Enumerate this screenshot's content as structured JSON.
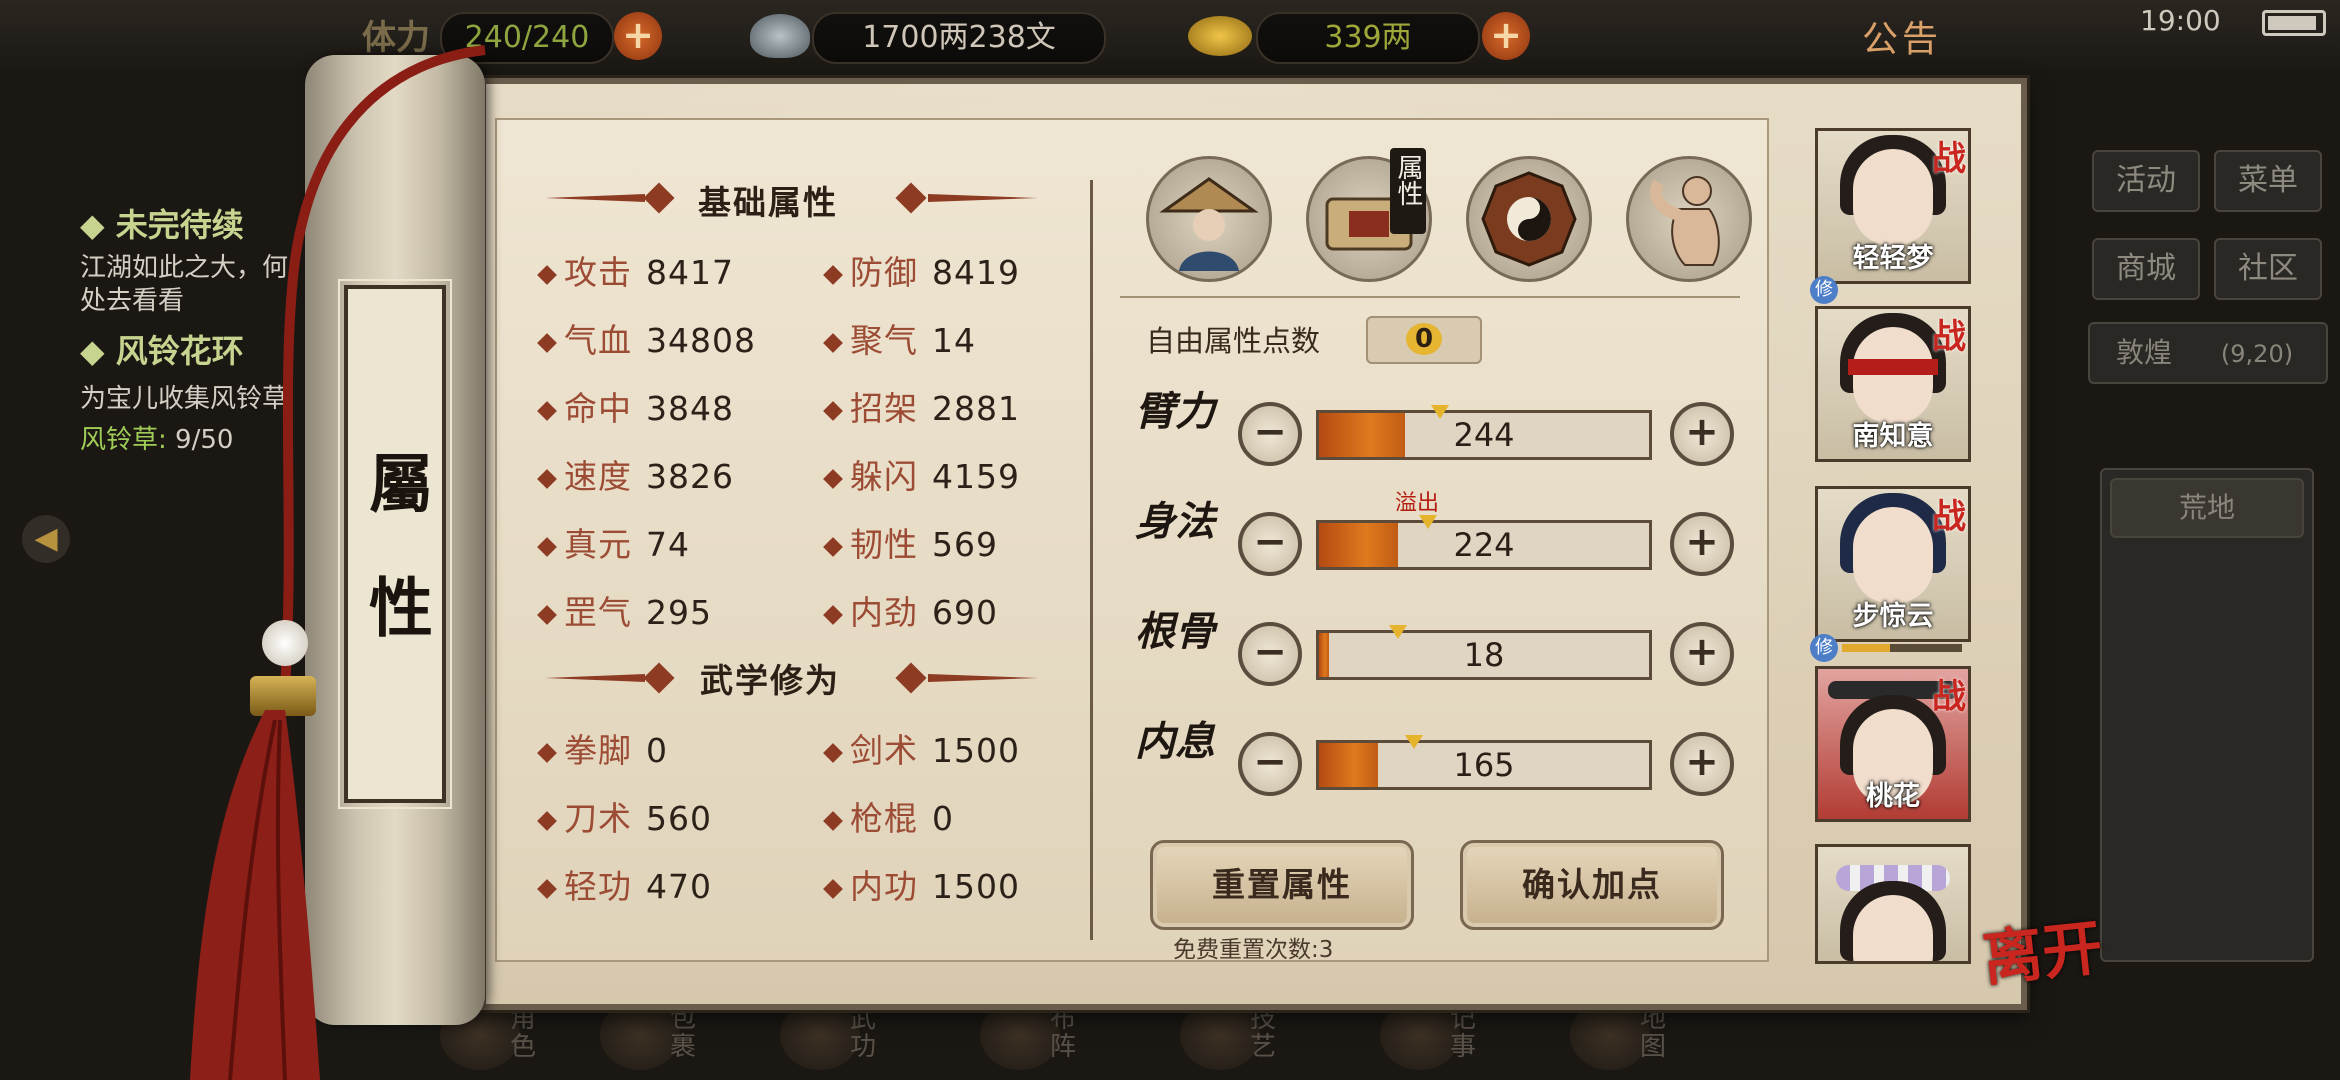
{
  "topbar": {
    "stamina_label": "体力",
    "stamina": "240/240",
    "silver": "1700两238文",
    "gold": "339两",
    "notice": "公告",
    "time": "19:00"
  },
  "quests": [
    {
      "title": "未完待续",
      "desc": "江湖如此之大，何处去看看"
    },
    {
      "title": "风铃花环",
      "desc": "为宝儿收集风铃草",
      "progress_label": "风铃草:",
      "progress": "9/50"
    }
  ],
  "side_menu": {
    "buttons": [
      "活动",
      "菜单",
      "商城",
      "社区"
    ],
    "location": "敦煌",
    "coords": "(9,20)",
    "area": "荒地"
  },
  "scroll_label": "屬性",
  "basic_attrs": {
    "title": "基础属性",
    "items": [
      {
        "label": "攻击",
        "value": "8417"
      },
      {
        "label": "防御",
        "value": "8419"
      },
      {
        "label": "气血",
        "value": "34808"
      },
      {
        "label": "聚气",
        "value": "14"
      },
      {
        "label": "命中",
        "value": "3848"
      },
      {
        "label": "招架",
        "value": "2881"
      },
      {
        "label": "速度",
        "value": "3826"
      },
      {
        "label": "躲闪",
        "value": "4159"
      },
      {
        "label": "真元",
        "value": "74"
      },
      {
        "label": "韧性",
        "value": "569"
      },
      {
        "label": "罡气",
        "value": "295"
      },
      {
        "label": "内劲",
        "value": "690"
      }
    ]
  },
  "martial": {
    "title": "武学修为",
    "items": [
      {
        "label": "拳脚",
        "value": "0"
      },
      {
        "label": "剑术",
        "value": "1500"
      },
      {
        "label": "刀术",
        "value": "560"
      },
      {
        "label": "枪棍",
        "value": "0"
      },
      {
        "label": "轻功",
        "value": "470"
      },
      {
        "label": "内功",
        "value": "1500"
      }
    ]
  },
  "tabs": {
    "active_label": "属性"
  },
  "free_points": {
    "label": "自由属性点数",
    "value": "0"
  },
  "attributes": [
    {
      "name": "臂力",
      "value": "244",
      "fill": 0.26
    },
    {
      "name": "身法",
      "value": "224",
      "fill": 0.24
    },
    {
      "name": "根骨",
      "value": "18",
      "fill": 0.03
    },
    {
      "name": "内息",
      "value": "165",
      "fill": 0.18
    }
  ],
  "overflow_label": "溢出",
  "buttons": {
    "reset": "重置属性",
    "confirm": "确认加点"
  },
  "reset_count": "免费重置次数:3",
  "characters": [
    {
      "name": "轻轻梦",
      "battle": "战"
    },
    {
      "name": "南知意",
      "battle": "战"
    },
    {
      "name": "步惊云",
      "battle": "战"
    },
    {
      "name": "桃花",
      "battle": "战"
    },
    {
      "name": "",
      "battle": ""
    }
  ],
  "cultivate_mark": "修",
  "leave": "离开",
  "bottom_nav": [
    "角色",
    "包裹",
    "武功",
    "布阵",
    "技艺",
    "记事",
    "地图"
  ]
}
